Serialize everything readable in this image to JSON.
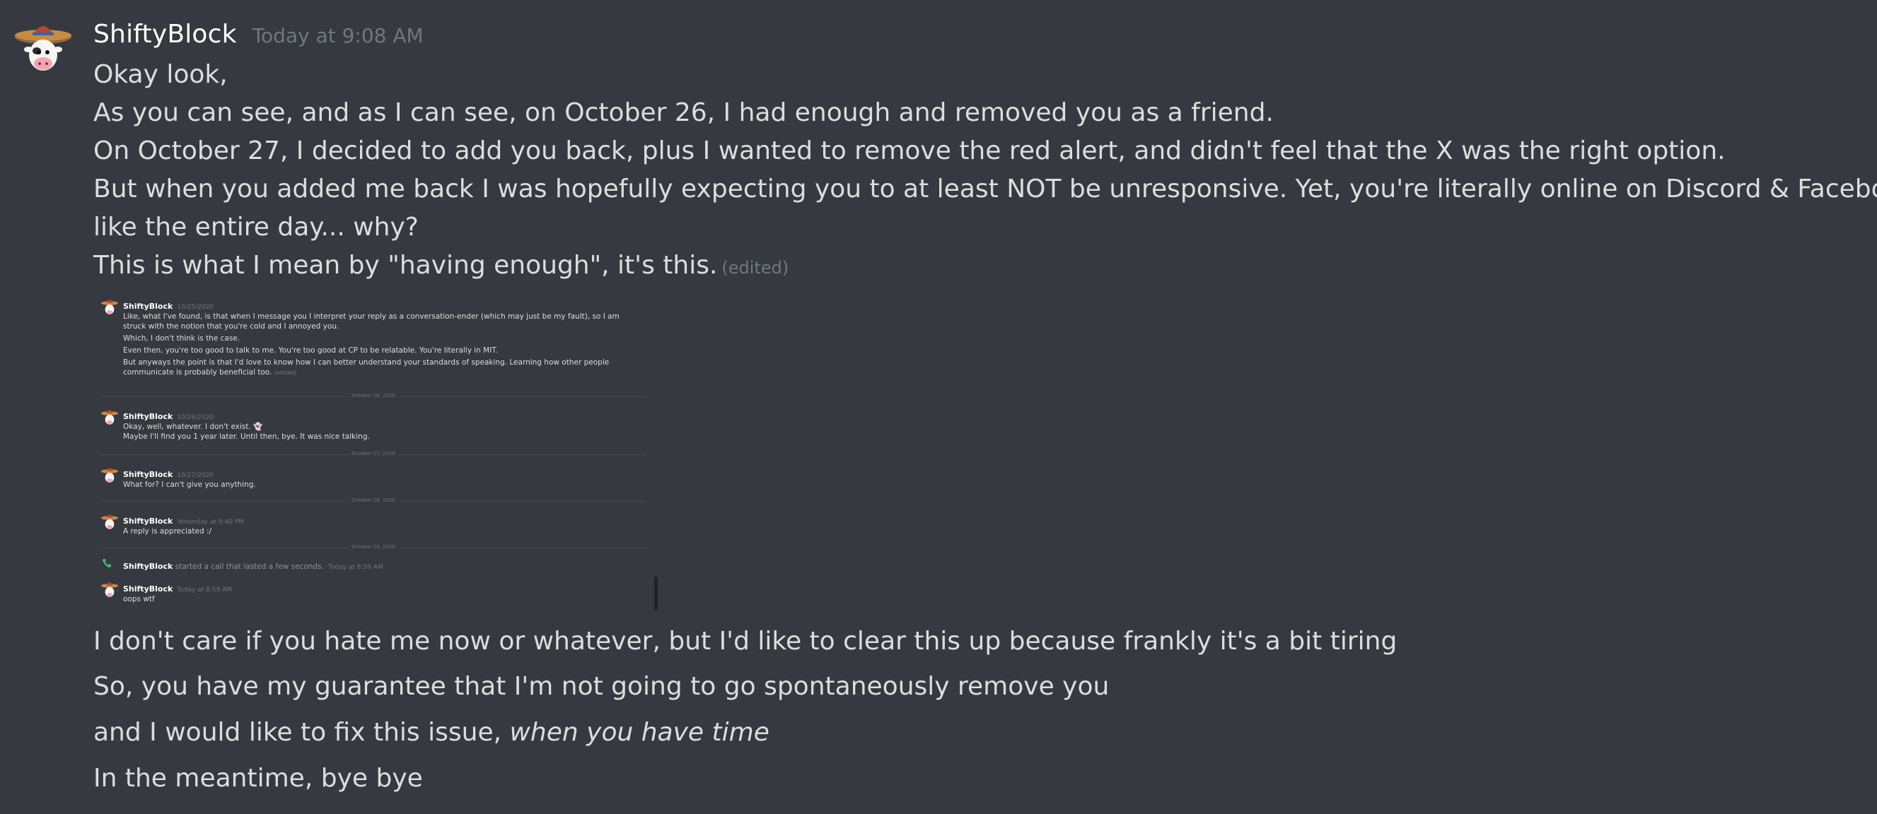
{
  "message": {
    "author": "ShiftyBlock",
    "timestamp": "Today at 9:08 AM",
    "lines": [
      "Okay look,",
      "As you can see, and as I can see, on October 26, I had enough and removed you as a friend.",
      "On October 27, I decided to add you back, plus I wanted to remove the red alert, and didn't feel that the X was the right option.",
      "But when you added me back I was hopefully expecting you to at least NOT be unresponsive. Yet, you're literally online on Discord & Facebook for",
      "like the entire day... why?",
      "This is what I mean by \"having enough\", it's this."
    ],
    "edited": "(edited)",
    "after_lines": [
      "I don't care if you hate me now or whatever, but I'd like to clear this up because frankly it's a bit tiring",
      "So, you have my guarantee that I'm not going to go spontaneously remove you"
    ],
    "fix_prefix": "and I would like to fix this issue, ",
    "fix_italic": "when you have time",
    "last_line": "In the meantime, bye bye"
  },
  "embed": {
    "msg1": {
      "author": "ShiftyBlock",
      "time": "10/25/2020",
      "lines": [
        "Like, what I've found, is that when I message you I interpret your reply as a conversation-ender (which may just be my fault), so I am struck with the notion that you're cold and I annoyed you.",
        "Which, I don't think is the case.",
        "Even then, you're too good to talk to me. You're too good at CP to be relatable. You're literally in MIT.",
        "But anyways the point is that I'd love to know how I can better understand your standards of speaking.  Learning how other people communicate is probably beneficial too."
      ],
      "edited": "(edited)"
    },
    "divider1": "October 26, 2020",
    "msg2": {
      "author": "ShiftyBlock",
      "time": "10/26/2020",
      "lines": [
        "Okay, well, whatever. I don't exist. 👻",
        "Maybe I'll find you 1 year later. Until then, bye. It was nice talking."
      ]
    },
    "divider2": "October 27, 2020",
    "msg3": {
      "author": "ShiftyBlock",
      "time": "10/27/2020",
      "lines": [
        "What for? I can't give you anything."
      ]
    },
    "divider3": "October 28, 2020",
    "msg4": {
      "author": "ShiftyBlock",
      "time": "Yesterday at 9:40 PM",
      "lines": [
        "A reply is appreciated :/"
      ]
    },
    "divider4": "October 29, 2020",
    "call": {
      "author": "ShiftyBlock",
      "text": " started a call that lasted a few seconds.",
      "time": "Today at 8:59 AM"
    },
    "msg5": {
      "author": "ShiftyBlock",
      "time": "Today at 8:59 AM",
      "lines": [
        "oops wtf"
      ]
    }
  },
  "colors": {
    "background": "#36393f",
    "text": "#dcddde",
    "muted": "#72767d",
    "author": "#ffffff"
  }
}
